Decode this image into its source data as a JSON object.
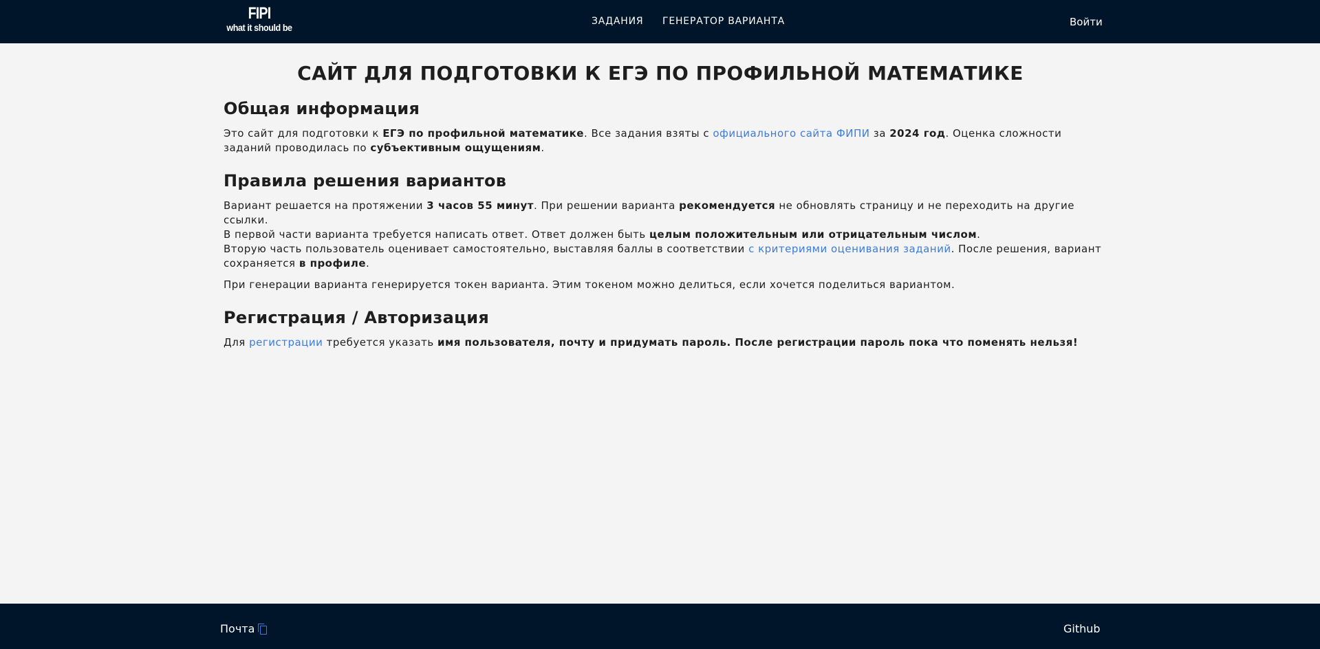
{
  "header": {
    "logo_line1": "FIPI",
    "logo_line2": "what it should be",
    "nav": [
      "ЗАДАНИЯ",
      "ГЕНЕРАТОР ВАРИАНТА"
    ],
    "login": "Войти"
  },
  "main": {
    "title": "САЙТ ДЛЯ ПОДГОТОВКИ К ЕГЭ ПО ПРОФИЛЬНОЙ МАТЕМАТИКЕ",
    "general": {
      "heading": "Общая информация",
      "t1": "Это сайт для подготовки к ",
      "b1": "ЕГЭ по профильной математике",
      "t2": ". Все задания взяты с ",
      "link": "официального сайта ФИПИ",
      "t3": " за ",
      "b2": "2024 год",
      "t4": ". Оценка сложности заданий проводилась по ",
      "b3": "субъективным ощущениям",
      "t5": "."
    },
    "rules": {
      "heading": "Правила решения вариантов",
      "t1": "Вариант решается на протяжении ",
      "b1": "3 часов 55 минут",
      "t2": ". При решении варианта ",
      "b2": "рекомендуется",
      "t3": " не обновлять страницу и не переходить на другие ссылки.",
      "t4": "В первой части варианта требуется написать ответ. Ответ должен быть ",
      "b3": "целым положительным или отрицательным числом",
      "t5": ".",
      "t6": "Вторую часть пользователь оценивает самостоятельно, выставляя баллы в соответствии ",
      "link": "с критериями оценивания заданий",
      "t7": ". После решения, вариант сохраняется ",
      "b4": "в профиле",
      "t8": ".",
      "p2": "При генерации варианта генерируется токен варианта. Этим токеном можно делиться, если хочется поделиться вариантом."
    },
    "auth": {
      "heading": "Регистрация / Авторизация",
      "t1": "Для ",
      "link": "регистрации",
      "t2": " требуется указать ",
      "b1": "имя пользователя, почту и придумать пароль",
      "t3": ". ",
      "b2": "После регистрации пароль пока что поменять нельзя!"
    }
  },
  "footer": {
    "mail": "Почта",
    "copy_icon": "copy-icon",
    "github": "Github"
  }
}
